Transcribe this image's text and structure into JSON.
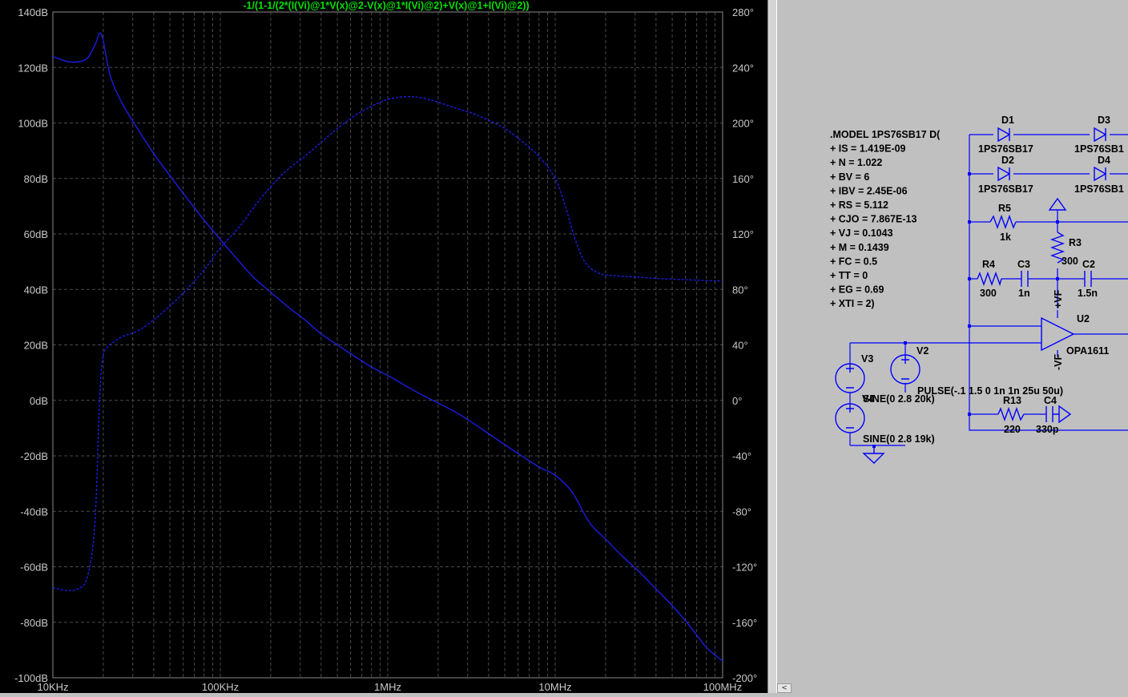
{
  "plot": {
    "title": "-1/(1-1/(2*(I(Vi)@1*V(x)@2-V(x)@1*I(Vi)@2)+V(x)@1+I(Vi)@2))",
    "title_color": "#00e000",
    "trace_color": "#1e1ef0",
    "left_axis": [
      "140dB",
      "120dB",
      "100dB",
      "80dB",
      "60dB",
      "40dB",
      "20dB",
      "0dB",
      "-20dB",
      "-40dB",
      "-60dB",
      "-80dB",
      "-100dB"
    ],
    "right_axis": [
      "280°",
      "240°",
      "200°",
      "160°",
      "120°",
      "80°",
      "40°",
      "0°",
      "-40°",
      "-80°",
      "-120°",
      "-160°",
      "-200°"
    ],
    "x_axis": [
      "10KHz",
      "100KHz",
      "1MHz",
      "10MHz",
      "100MHz"
    ]
  },
  "chart_data": {
    "type": "line",
    "xscale": "log",
    "xlim": [
      10000,
      100000000
    ],
    "ylim_left": [
      -100,
      140
    ],
    "ylim_right": [
      -200,
      280
    ],
    "grid": true,
    "series": [
      {
        "axis": "left",
        "style": "solid",
        "x": [
          10000,
          12600,
          15800,
          17800,
          19500,
          22000,
          26000,
          32000,
          40000,
          50000,
          63000,
          80000,
          100000,
          130000,
          160000,
          200000,
          250000,
          320000,
          400000,
          500000,
          630000,
          800000,
          1000000,
          1300000,
          1600000,
          2000000,
          2500000,
          3200000,
          4000000,
          5000000,
          6300000,
          8000000,
          10000000,
          12600000,
          16000000,
          20000000,
          25000000,
          32000000,
          40000000,
          50000000,
          63000000,
          80000000,
          100000000
        ],
        "values": [
          124,
          122,
          123,
          128,
          132,
          117,
          107,
          98,
          89,
          81,
          73,
          65,
          58,
          50,
          44,
          39,
          34,
          29,
          24,
          20,
          16,
          12,
          9,
          5,
          2,
          -1,
          -4,
          -8,
          -12,
          -16,
          -20,
          -24,
          -27,
          -33,
          -44,
          -50,
          -56,
          -62,
          -68,
          -74,
          -81,
          -89,
          -94
        ]
      },
      {
        "axis": "right",
        "style": "dashed",
        "x": [
          10000,
          12000,
          14000,
          16000,
          17800,
          19000,
          19800,
          21000,
          23000,
          26000,
          32000,
          40000,
          50000,
          63000,
          80000,
          100000,
          130000,
          160000,
          200000,
          250000,
          320000,
          400000,
          500000,
          630000,
          800000,
          1000000,
          1300000,
          1600000,
          2000000,
          2500000,
          3200000,
          4000000,
          5000000,
          6300000,
          8000000,
          10000000,
          11500000,
          13000000,
          15000000,
          18000000,
          22000000,
          30000000,
          40000000,
          60000000,
          100000000
        ],
        "values": [
          -135,
          -137,
          -136,
          -128,
          -90,
          0,
          30,
          38,
          42,
          46,
          50,
          58,
          68,
          80,
          94,
          110,
          125,
          140,
          154,
          166,
          176,
          186,
          196,
          205,
          212,
          217,
          219,
          218,
          215,
          211,
          207,
          202,
          196,
          187,
          176,
          160,
          140,
          118,
          100,
          92,
          90,
          89,
          88,
          87,
          86
        ]
      }
    ]
  },
  "schematic": {
    "model_lines": [
      ".MODEL 1PS76SB17 D(",
      "+ IS = 1.419E-09",
      "+ N = 1.022",
      "+ BV = 6",
      "+ IBV = 2.45E-06",
      "+ RS = 5.112",
      "+ CJO = 7.867E-13",
      "+ VJ = 0.1043",
      "+ M = 0.1439",
      "+ FC = 0.5",
      "+ TT = 0",
      "+ EG = 0.69",
      "+ XTI = 2)"
    ],
    "labels": {
      "d1": "D1",
      "d2": "D2",
      "d3": "D3",
      "d4": "D4",
      "d1_val": "1PS76SB17",
      "d2_val": "1PS76SB17",
      "d3_val": "1PS76SB1",
      "d4_val": "1PS76SB1",
      "r5": "R5",
      "r5_val": "1k",
      "r3": "R3",
      "r3_val": "300",
      "r4": "R4",
      "r4_val": "300",
      "c3": "C3",
      "c3_val": "1n",
      "c2": "C2",
      "c2_val": "1.5n",
      "u2": "U2",
      "u2_val": "OPA1611",
      "plus_vf": "+VF",
      "minus_vf": "-VF",
      "v3": "V3",
      "v2": "V2",
      "v4_val": "SINE(0 2.8 20k)",
      "v4": "V4",
      "v2_val": "PULSE(-.1 1.5 0 1n 1n 25u 50u)",
      "r13": "R13",
      "r13_val": "220",
      "c4": "C4",
      "c4_val": "330p",
      "v3_val": "SINE(0 2.8 19k)"
    }
  },
  "scrollbar": {
    "left_arrow": "<"
  }
}
